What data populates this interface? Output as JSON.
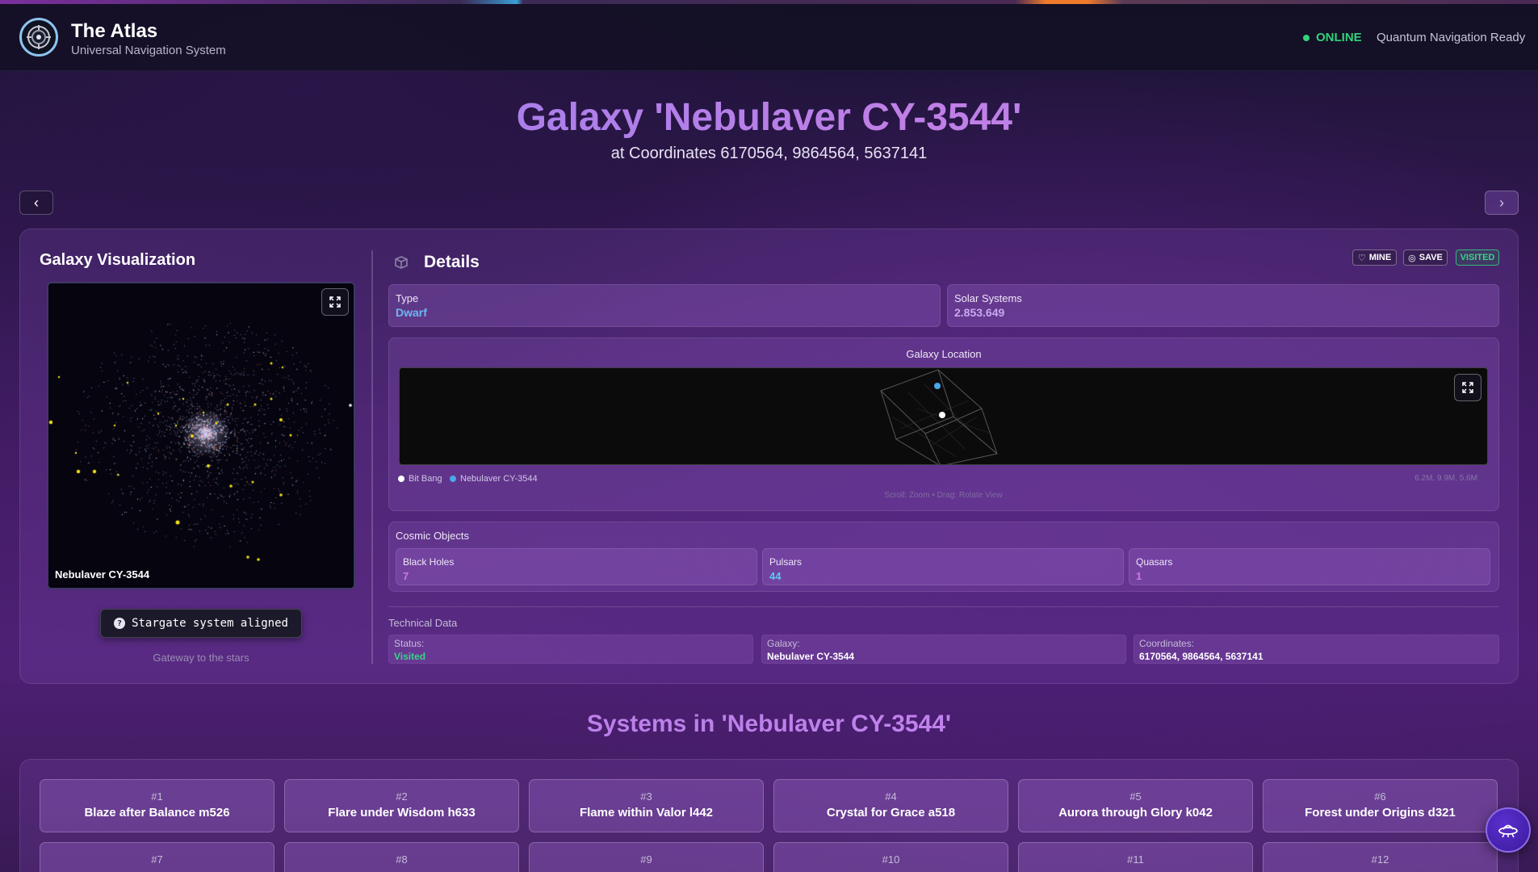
{
  "header": {
    "title": "The Atlas",
    "subtitle": "Universal Navigation System",
    "status": "ONLINE",
    "status_detail": "Quantum Navigation Ready"
  },
  "hero": {
    "title": "Galaxy 'Nebulaver CY-3544'",
    "subtitle": "at Coordinates 6170564, 9864564, 5637141"
  },
  "nav": {
    "prev_icon": "chevron-left-icon",
    "next_icon": "chevron-right-icon"
  },
  "visualization": {
    "title": "Galaxy Visualization",
    "label": "Nebulaver CY-3544",
    "stargate_text": "Stargate system aligned",
    "stargate_icon": "?",
    "gateway_text": "Gateway to the stars"
  },
  "details": {
    "title": "Details",
    "actions": {
      "mine": "MINE",
      "save": "SAVE",
      "visited": "VISITED"
    },
    "type_label": "Type",
    "type_value": "Dwarf",
    "solar_label": "Solar Systems",
    "solar_value": "2.853.649",
    "location_title": "Galaxy Location",
    "legend": {
      "origin": "Bit Bang",
      "current": "Nebulaver CY-3544"
    },
    "location_coords": "6.2M, 9.9M, 5.6M",
    "hint": "Scroll: Zoom • Drag: Rotate View",
    "cosmic_title": "Cosmic Objects",
    "cosmic": [
      {
        "label": "Black Holes",
        "value": "7",
        "color": "#c87ae8"
      },
      {
        "label": "Pulsars",
        "value": "44",
        "color": "#5ec8f0"
      },
      {
        "label": "Quasars",
        "value": "1",
        "color": "#c87ae8"
      }
    ],
    "tech_title": "Technical Data",
    "tech": [
      {
        "label": "Status:",
        "value": "Visited"
      },
      {
        "label": "Galaxy:",
        "value": "Nebulaver CY-3544"
      },
      {
        "label": "Coordinates:",
        "value": "6170564, 9864564, 5637141"
      }
    ]
  },
  "systems": {
    "title": "Systems in 'Nebulaver CY-3544'",
    "items": [
      {
        "num": "#1",
        "name": "Blaze after Balance m526"
      },
      {
        "num": "#2",
        "name": "Flare under Wisdom h633"
      },
      {
        "num": "#3",
        "name": "Flame within Valor l442"
      },
      {
        "num": "#4",
        "name": "Crystal for Grace a518"
      },
      {
        "num": "#5",
        "name": "Aurora through Glory k042"
      },
      {
        "num": "#6",
        "name": "Forest under Origins d321"
      },
      {
        "num": "#7",
        "name": ""
      },
      {
        "num": "#8",
        "name": ""
      },
      {
        "num": "#9",
        "name": ""
      },
      {
        "num": "#10",
        "name": ""
      },
      {
        "num": "#11",
        "name": ""
      },
      {
        "num": "#12",
        "name": ""
      }
    ]
  },
  "colors": {
    "accent": "#9b7ef0",
    "online": "#34d17a",
    "visited": "#39d487",
    "type": "#6fb6f5"
  }
}
